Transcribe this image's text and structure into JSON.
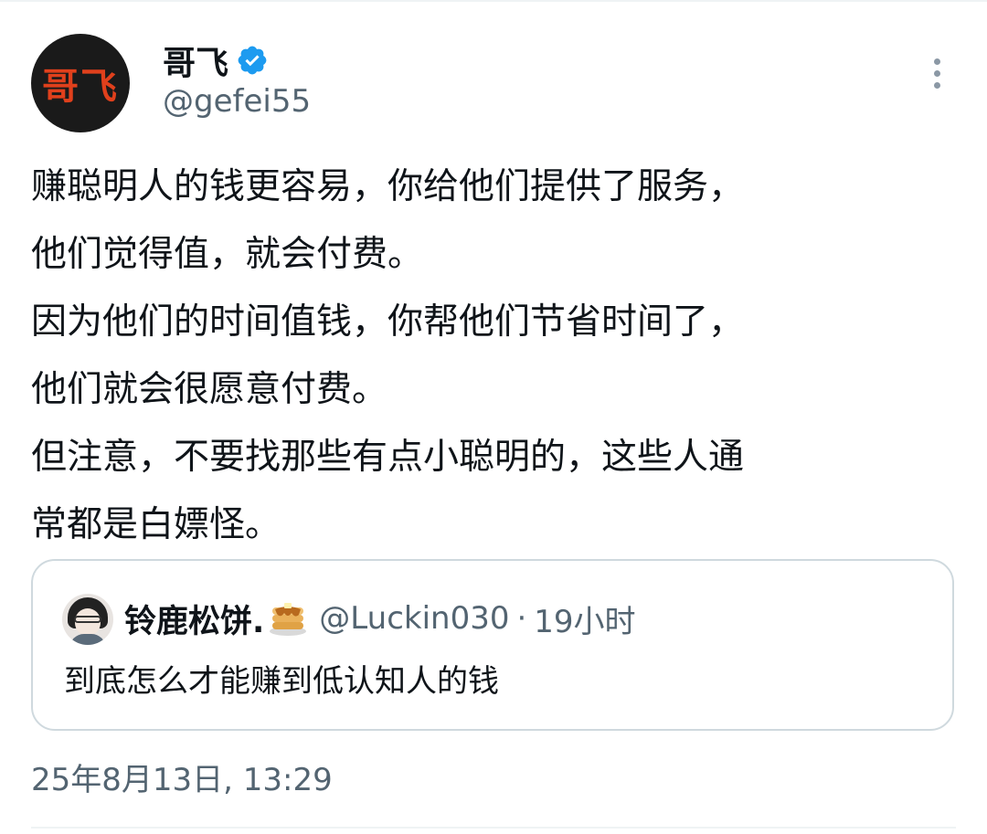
{
  "author": {
    "avatar_text": "哥飞",
    "display_name": "哥飞",
    "handle": "@gefei55",
    "verified_icon": "verified-badge-icon",
    "accent_color": "#1d9bf0"
  },
  "tweet": {
    "lines": [
      "赚聪明人的钱更容易，你给他们提供了服务，",
      "他们觉得值，就会付费。",
      "因为他们的时间值钱，你帮他们节省时间了，",
      "他们就会很愿意付费。",
      "但注意，不要找那些有点小聪明的，这些人通",
      "常都是白嫖怪。"
    ],
    "timestamp": "25年8月13日, 13:29"
  },
  "quote": {
    "display_name": "铃鹿松饼.",
    "name_emoji_icon": "pancake-icon",
    "handle": "@Luckin030",
    "separator": "·",
    "time": "19小时",
    "text": "到底怎么才能赚到低认知人的钱"
  },
  "colors": {
    "text_primary": "#0f1419",
    "text_secondary": "#536471",
    "border": "#cfd9de"
  }
}
